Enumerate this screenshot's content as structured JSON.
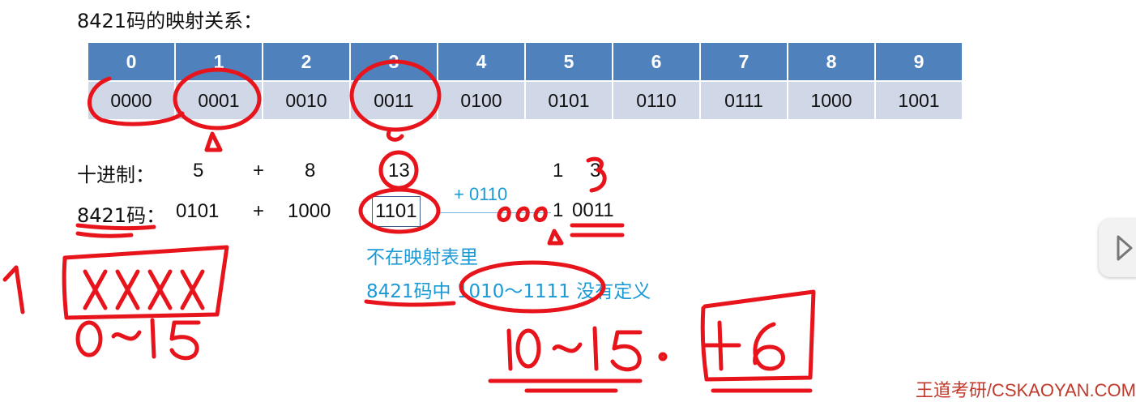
{
  "title": "8421码的映射关系：",
  "mapping": {
    "digits": [
      "0",
      "1",
      "2",
      "3",
      "4",
      "5",
      "6",
      "7",
      "8",
      "9"
    ],
    "codes": [
      "0000",
      "0001",
      "0010",
      "0011",
      "0100",
      "0101",
      "0110",
      "0111",
      "1000",
      "1001"
    ]
  },
  "decimal_row": {
    "label": "十进制：",
    "a": "5",
    "plus": "+",
    "b": "8",
    "result": "13",
    "r1": "1",
    "r2": "3"
  },
  "bcd_row": {
    "label": "8421码：",
    "a": "0101",
    "plus": "+",
    "b": "1000",
    "result": "1101",
    "correction": "+ 0110",
    "final_high": "1",
    "final_low": "0011"
  },
  "notes": {
    "not_in_table": "不在映射表里",
    "undefined": "8421码中 1010～1111 没有定义"
  },
  "watermark": "王道考研/CSKAOYAN.COM",
  "annotation_color": "#e8141c"
}
